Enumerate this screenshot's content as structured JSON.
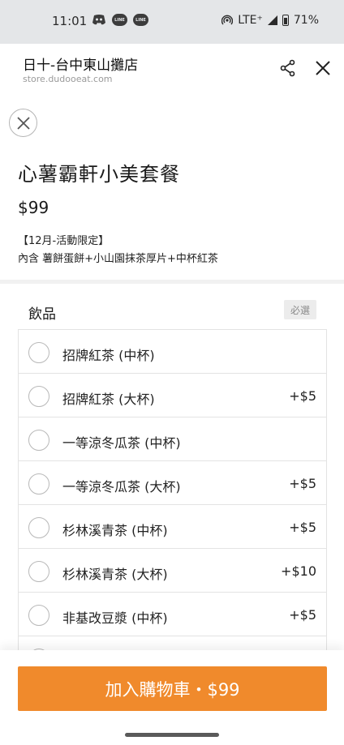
{
  "status_bar": {
    "time": "11:01",
    "network": "LTE⁺",
    "battery": "71%",
    "line_icon_text": "LINE"
  },
  "header": {
    "store_name": "日十-台中東山攤店",
    "url": "store.dudooeat.com"
  },
  "product": {
    "name": "心薯霸軒小美套餐",
    "price": "$99",
    "description_line1": "【12月-活動限定】",
    "description_line2": "內含 薯餅蛋餅+小山園抹茶厚片+中杯紅茶"
  },
  "section": {
    "title": "飲品",
    "required_label": "必選"
  },
  "options": [
    {
      "label": "招牌紅茶 (中杯)",
      "price": ""
    },
    {
      "label": "招牌紅茶 (大杯)",
      "price": "+$5"
    },
    {
      "label": "一等涼冬瓜茶 (中杯)",
      "price": ""
    },
    {
      "label": "一等涼冬瓜茶 (大杯)",
      "price": "+$5"
    },
    {
      "label": "杉林溪青茶 (中杯)",
      "price": "+$5"
    },
    {
      "label": "杉林溪青茶 (大杯)",
      "price": "+$10"
    },
    {
      "label": "非基改豆漿 (中杯)",
      "price": "+$5"
    }
  ],
  "cart_button": {
    "label": "加入購物車・$99"
  },
  "colors": {
    "accent": "#f08a2c",
    "status_bar_bg": "#e4e6e8"
  }
}
